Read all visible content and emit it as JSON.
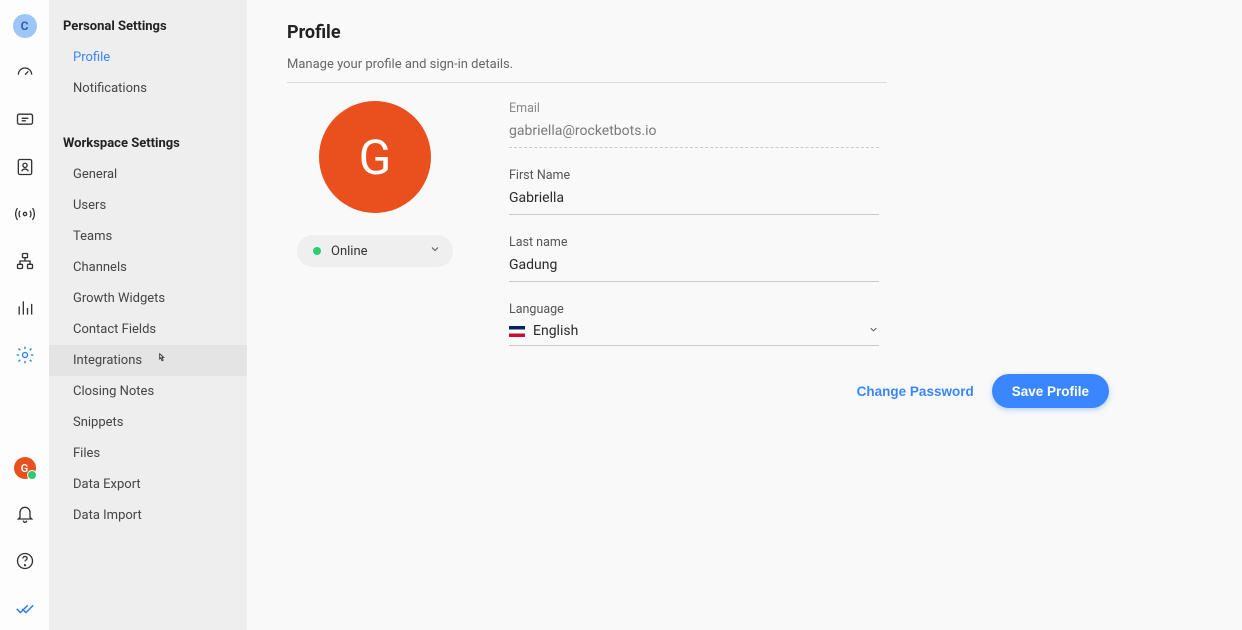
{
  "rail": {
    "workspace_initial": "C",
    "avatar_initial": "G"
  },
  "sidebar": {
    "personal": {
      "title": "Personal Settings",
      "items": [
        {
          "label": "Profile"
        },
        {
          "label": "Notifications"
        }
      ]
    },
    "workspace": {
      "title": "Workspace Settings",
      "items": [
        {
          "label": "General"
        },
        {
          "label": "Users"
        },
        {
          "label": "Teams"
        },
        {
          "label": "Channels"
        },
        {
          "label": "Growth Widgets"
        },
        {
          "label": "Contact Fields"
        },
        {
          "label": "Integrations"
        },
        {
          "label": "Closing Notes"
        },
        {
          "label": "Snippets"
        },
        {
          "label": "Files"
        },
        {
          "label": "Data Export"
        },
        {
          "label": "Data Import"
        }
      ]
    }
  },
  "page": {
    "title": "Profile",
    "subtitle": "Manage your profile and sign-in details."
  },
  "avatar": {
    "initial": "G",
    "status_label": "Online"
  },
  "form": {
    "email_label": "Email",
    "email_value": "gabriella@rocketbots.io",
    "first_name_label": "First Name",
    "first_name_value": "Gabriella",
    "last_name_label": "Last name",
    "last_name_value": "Gadung",
    "language_label": "Language",
    "language_value": "English"
  },
  "actions": {
    "change_password": "Change Password",
    "save_profile": "Save Profile"
  }
}
